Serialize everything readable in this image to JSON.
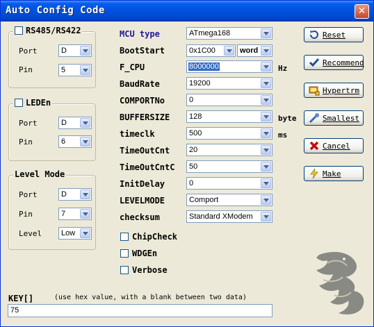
{
  "window": {
    "title": "Auto Config Code",
    "close_glyph": "✕"
  },
  "rs485": {
    "title": "RS485/RS422",
    "port_label": "Port",
    "port_value": "D",
    "pin_label": "Pin",
    "pin_value": "5"
  },
  "leden": {
    "title": "LEDEn",
    "port_label": "Port",
    "port_value": "D",
    "pin_label": "Pin",
    "pin_value": "6"
  },
  "level_mode": {
    "title": "Level Mode",
    "port_label": "Port",
    "port_value": "D",
    "pin_label": "Pin",
    "pin_value": "7",
    "level_label": "Level",
    "level_value": "Low"
  },
  "config": {
    "mcu_type": {
      "label": "MCU type",
      "value": "ATmega168"
    },
    "bootstart": {
      "label": "BootStart",
      "value": "0x1C00",
      "unit_value": "word"
    },
    "f_cpu": {
      "label": "F_CPU",
      "value": "8000000",
      "unit": "Hz"
    },
    "baudrate": {
      "label": "BaudRate",
      "value": "19200"
    },
    "comportno": {
      "label": "COMPORTNo",
      "value": "0"
    },
    "buffersize": {
      "label": "BUFFERSIZE",
      "value": "128",
      "unit": "byte"
    },
    "timeclk": {
      "label": "timeclk",
      "value": "500",
      "unit": "ms"
    },
    "timeoutcnt": {
      "label": "TimeOutCnt",
      "value": "20"
    },
    "timeoutcntc": {
      "label": "TimeOutCntC",
      "value": "50"
    },
    "initdelay": {
      "label": "InitDelay",
      "value": "0"
    },
    "levelmode": {
      "label": "LEVELMODE",
      "value": "Comport"
    },
    "checksum": {
      "label": "checksum",
      "value": "Standard XModem"
    }
  },
  "options": {
    "chipcheck": "ChipCheck",
    "wdgen": "WDGEn",
    "verbose": "Verbose"
  },
  "buttons": {
    "reset": "Reset",
    "recommend": "Recommend",
    "hypertrm": "Hypertrm",
    "smallest": "Smallest",
    "cancel": "Cancel",
    "make": "Make"
  },
  "key": {
    "label": "KEY[]",
    "hint": "(use hex value, with a blank between two data)",
    "value": "75"
  },
  "icons": {
    "reset": "reset-icon",
    "recommend": "checkmark-icon",
    "hypertrm": "hyperterminal-icon",
    "smallest": "smallest-icon",
    "cancel": "cancel-x-icon",
    "make": "lightning-icon",
    "logo": "dragon-logo"
  },
  "colors": {
    "title_bar": "#0054e3",
    "accent_label": "#1a1a9c",
    "selection": "#316ac5"
  }
}
